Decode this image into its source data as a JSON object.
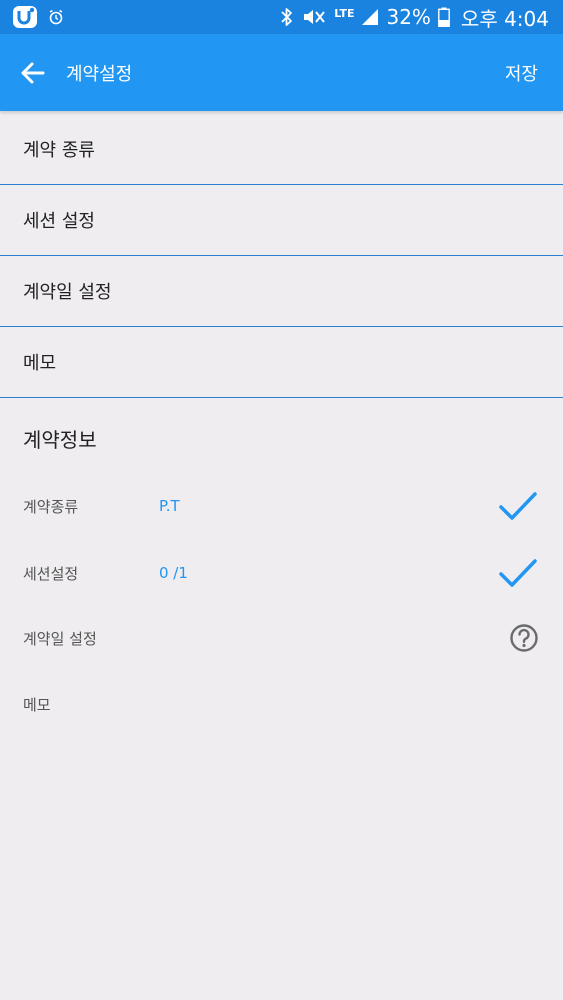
{
  "status_bar": {
    "battery_percent": "32%",
    "network": "LTE",
    "time": "오후 4:04"
  },
  "app_bar": {
    "title": "계약설정",
    "save_label": "저장"
  },
  "menu": {
    "items": [
      {
        "label": "계약 종류"
      },
      {
        "label": "세션 설정"
      },
      {
        "label": "계약일 설정"
      },
      {
        "label": "메모"
      }
    ]
  },
  "info": {
    "title": "계약정보",
    "rows": [
      {
        "label": "계약종류",
        "value": "P.T",
        "icon": "check-icon"
      },
      {
        "label": "세션설정",
        "value": "0 /1",
        "icon": "check-icon"
      },
      {
        "label": "계약일 설정",
        "value": "",
        "icon": "help-circle-icon"
      },
      {
        "label": "메모",
        "value": "",
        "icon": ""
      }
    ]
  },
  "colors": {
    "status_bar": "#1a83df",
    "app_bar": "#2196f3",
    "accent": "#2196f3",
    "divider": "#2a7fd0",
    "background": "#efedf0"
  }
}
